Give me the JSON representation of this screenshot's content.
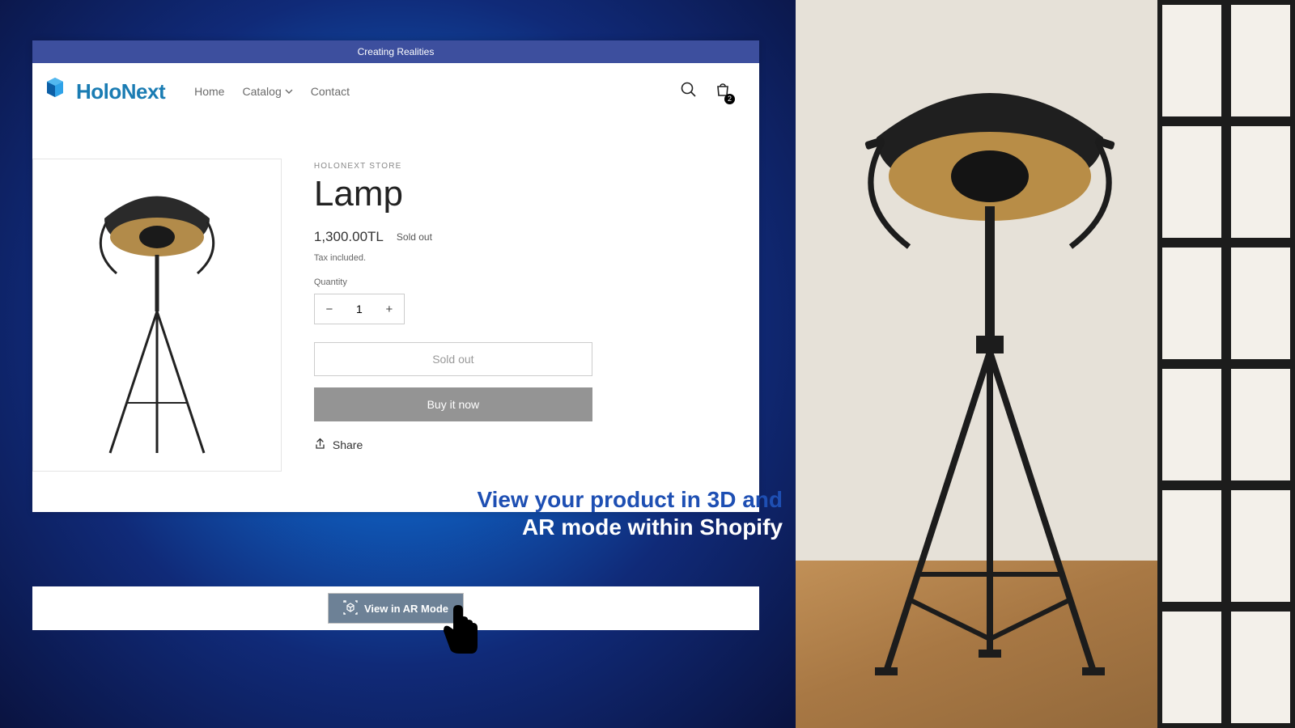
{
  "banner": {
    "tagline": "Creating Realities"
  },
  "brand": {
    "name": "HoloNext"
  },
  "nav": {
    "home": "Home",
    "catalog": "Catalog",
    "contact": "Contact"
  },
  "cart": {
    "count": "2"
  },
  "product": {
    "vendor": "HOLONEXT STORE",
    "title": "Lamp",
    "price": "1,300.00TL",
    "availability": "Sold out",
    "tax": "Tax included.",
    "qty_label": "Quantity",
    "qty_value": "1",
    "soldout_btn": "Sold out",
    "buy_btn": "Buy it now",
    "share": "Share"
  },
  "marketing": {
    "line1": "View your product in 3D and",
    "line2": "AR mode within Shopify"
  },
  "ar": {
    "button": "View in AR Mode"
  }
}
